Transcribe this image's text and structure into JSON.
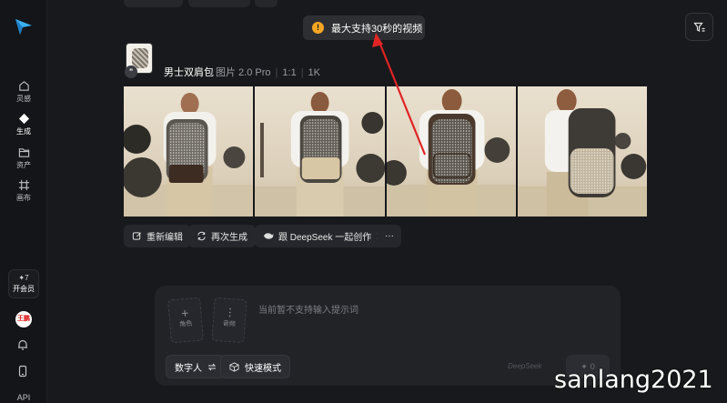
{
  "sidebar": {
    "items": [
      {
        "label": "灵感",
        "icon": "home-icon"
      },
      {
        "label": "生成",
        "icon": "diamond-icon"
      },
      {
        "label": "资产",
        "icon": "folder-icon"
      },
      {
        "label": "画布",
        "icon": "canvas-icon"
      }
    ],
    "member_points": "✦7",
    "member_label": "开会员",
    "avatar_text": "王鹏",
    "api_label": "API"
  },
  "toast": {
    "icon": "warning-icon",
    "text": "最大支持30秒的视频",
    "color": "#f5a623"
  },
  "post": {
    "title": "男士双肩包",
    "model": "图片 2.0 Pro",
    "ratio": "1:1",
    "resolution": "1K",
    "image_count": 4
  },
  "actions": {
    "re_edit": "重新编辑",
    "regenerate": "再次生成",
    "deepseek": "跟 DeepSeek 一起创作",
    "more": "···"
  },
  "prompt": {
    "slot_role": "角色",
    "slot_audio": "音频",
    "placeholder": "当前暂不支持输入提示词",
    "mode_digital_human": "数字人",
    "mode_fast": "快速模式",
    "deepseek_watermark": "DeepSeek",
    "send_value": "0"
  },
  "watermark": "sanlang2021",
  "colors": {
    "annotation_arrow": "#e02424",
    "background": "#18191c"
  }
}
